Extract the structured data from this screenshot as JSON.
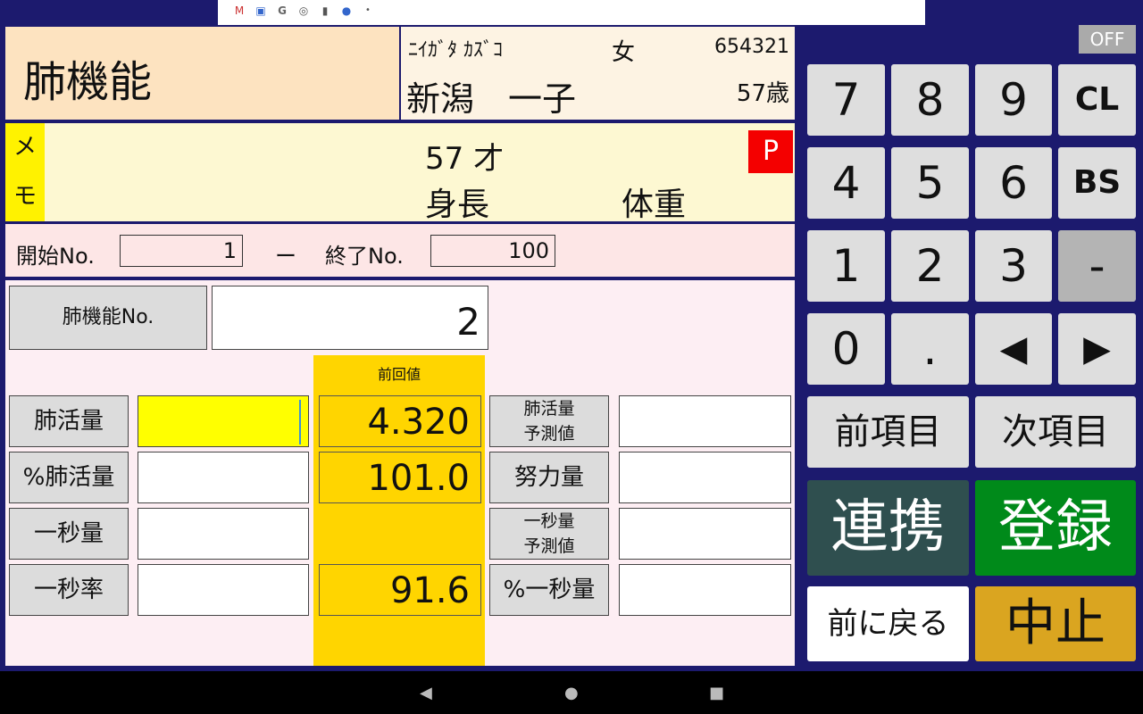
{
  "status_icons": [
    "gmail-icon",
    "app-icon",
    "google-icon",
    "sync-icon",
    "sd-card-icon",
    "globe-icon",
    "dot-icon"
  ],
  "header": {
    "title": "肺機能",
    "patient": {
      "kana": "ﾆｲｶﾞﾀ ｶｽﾞｺ",
      "sex": "女",
      "id": "654321",
      "name": "新潟　一子",
      "age": "57歳"
    }
  },
  "memo": {
    "label_top": "メ",
    "label_bottom": "モ",
    "age": "57 才",
    "height_label": "身長",
    "weight_label": "体重",
    "badge": "P"
  },
  "range": {
    "start_label": "開始No.",
    "start_value": "1",
    "dash": "ー",
    "end_label": "終了No.",
    "end_value": "100"
  },
  "form": {
    "no_label": "肺機能No.",
    "no_value": "2",
    "prev_header": "前回値",
    "rows": [
      {
        "label": "肺活量",
        "value": "",
        "prev": "4.320",
        "right_label": "肺活量\n予測値",
        "right_value": ""
      },
      {
        "label": "%肺活量",
        "value": "",
        "prev": "101.0",
        "right_label": "努力量",
        "right_value": ""
      },
      {
        "label": "一秒量",
        "value": "",
        "prev": "",
        "right_label": "一秒量\n予測値",
        "right_value": ""
      },
      {
        "label": "一秒率",
        "value": "",
        "prev": "91.6",
        "right_label": "%一秒量",
        "right_value": ""
      }
    ]
  },
  "keypad": {
    "off": "OFF",
    "keys": [
      "7",
      "8",
      "9",
      "CL",
      "4",
      "5",
      "6",
      "BS",
      "1",
      "2",
      "3",
      "-",
      "0",
      ".",
      "◀",
      "▶"
    ],
    "prev_item": "前項目",
    "next_item": "次項目",
    "link": "連携",
    "register": "登録",
    "back": "前に戻る",
    "cancel": "中止"
  },
  "colors": {
    "frame": "#1c1a6e",
    "highlight_input": "#ffff00",
    "prev_column": "#ffd500",
    "link_button": "#2f4f4f",
    "register_button": "#008a1a",
    "cancel_button": "#daa520",
    "p_badge": "#f40000"
  }
}
